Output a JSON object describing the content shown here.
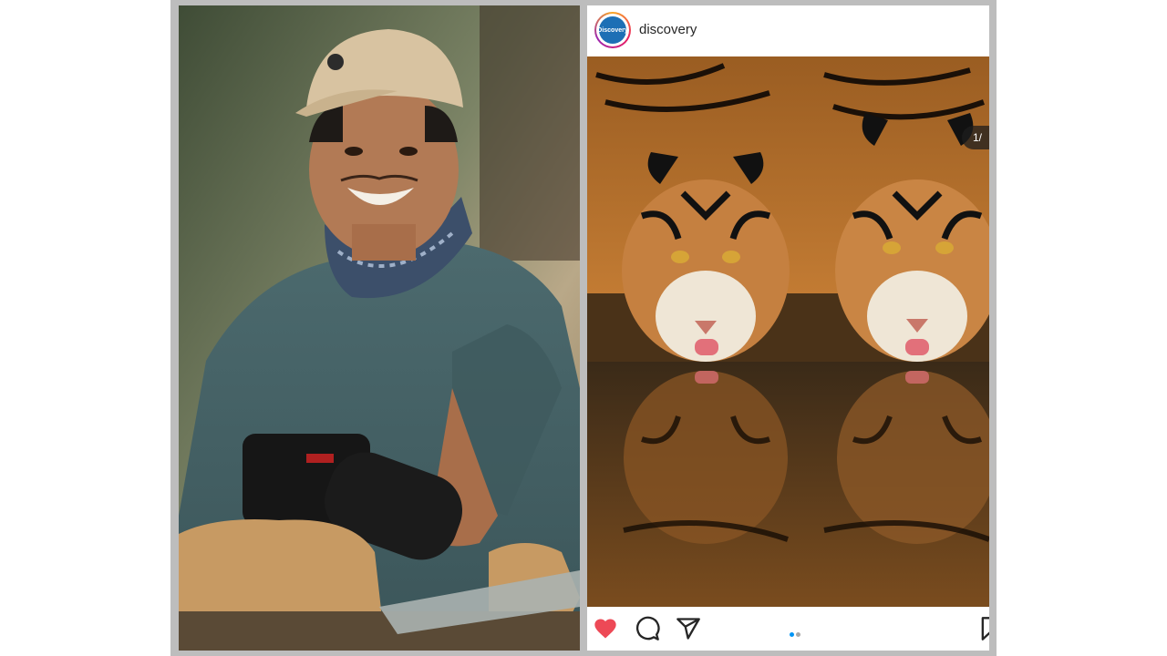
{
  "post": {
    "username": "discovery",
    "avatar_text": "Discovery",
    "image_counter": "1/",
    "carousel": {
      "total_dots": 2,
      "active_index": 0
    },
    "liked": true
  },
  "icons": {
    "like": "heart-icon",
    "comment": "comment-icon",
    "share": "send-icon",
    "save": "bookmark-icon"
  },
  "colors": {
    "like_active": "#ed4956",
    "dot_active": "#0095f6",
    "dot_inactive": "#a8a8a8",
    "avatar_brand": "#1d6fb5"
  }
}
